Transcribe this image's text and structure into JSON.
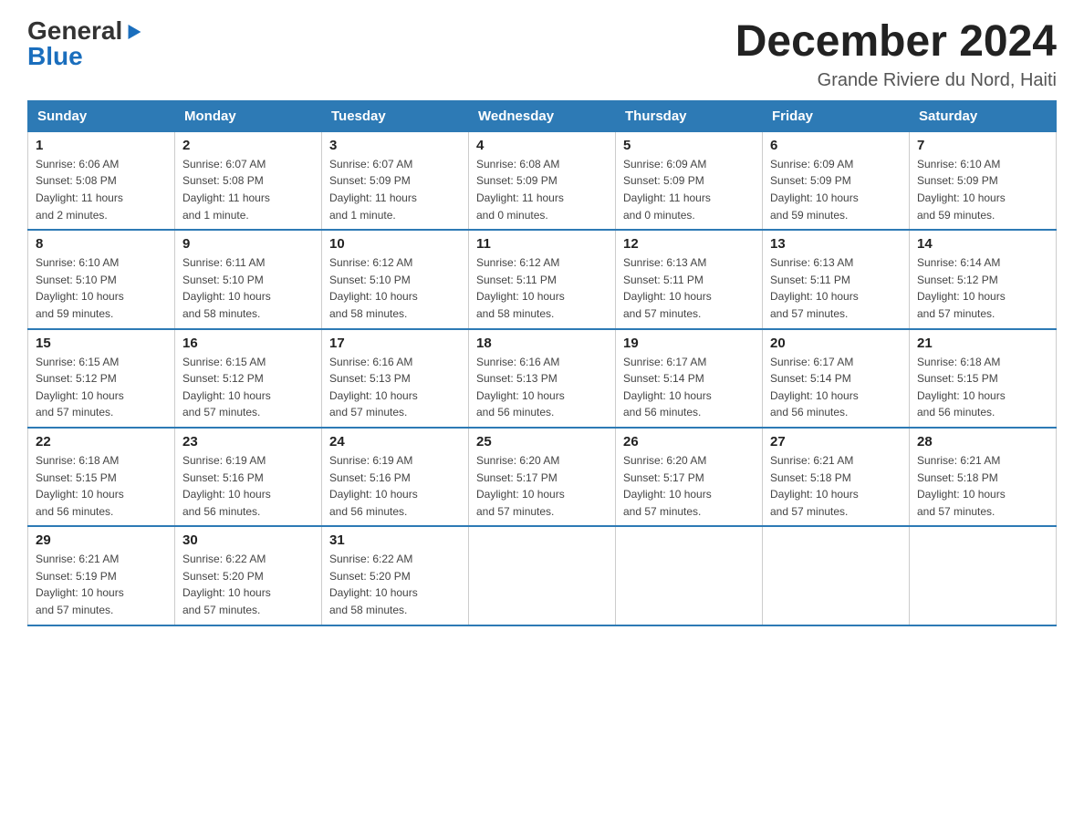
{
  "header": {
    "logo_general": "General",
    "logo_blue": "Blue",
    "month_title": "December 2024",
    "location": "Grande Riviere du Nord, Haiti"
  },
  "days_of_week": [
    "Sunday",
    "Monday",
    "Tuesday",
    "Wednesday",
    "Thursday",
    "Friday",
    "Saturday"
  ],
  "weeks": [
    [
      {
        "day": "1",
        "info": "Sunrise: 6:06 AM\nSunset: 5:08 PM\nDaylight: 11 hours\nand 2 minutes."
      },
      {
        "day": "2",
        "info": "Sunrise: 6:07 AM\nSunset: 5:08 PM\nDaylight: 11 hours\nand 1 minute."
      },
      {
        "day": "3",
        "info": "Sunrise: 6:07 AM\nSunset: 5:09 PM\nDaylight: 11 hours\nand 1 minute."
      },
      {
        "day": "4",
        "info": "Sunrise: 6:08 AM\nSunset: 5:09 PM\nDaylight: 11 hours\nand 0 minutes."
      },
      {
        "day": "5",
        "info": "Sunrise: 6:09 AM\nSunset: 5:09 PM\nDaylight: 11 hours\nand 0 minutes."
      },
      {
        "day": "6",
        "info": "Sunrise: 6:09 AM\nSunset: 5:09 PM\nDaylight: 10 hours\nand 59 minutes."
      },
      {
        "day": "7",
        "info": "Sunrise: 6:10 AM\nSunset: 5:09 PM\nDaylight: 10 hours\nand 59 minutes."
      }
    ],
    [
      {
        "day": "8",
        "info": "Sunrise: 6:10 AM\nSunset: 5:10 PM\nDaylight: 10 hours\nand 59 minutes."
      },
      {
        "day": "9",
        "info": "Sunrise: 6:11 AM\nSunset: 5:10 PM\nDaylight: 10 hours\nand 58 minutes."
      },
      {
        "day": "10",
        "info": "Sunrise: 6:12 AM\nSunset: 5:10 PM\nDaylight: 10 hours\nand 58 minutes."
      },
      {
        "day": "11",
        "info": "Sunrise: 6:12 AM\nSunset: 5:11 PM\nDaylight: 10 hours\nand 58 minutes."
      },
      {
        "day": "12",
        "info": "Sunrise: 6:13 AM\nSunset: 5:11 PM\nDaylight: 10 hours\nand 57 minutes."
      },
      {
        "day": "13",
        "info": "Sunrise: 6:13 AM\nSunset: 5:11 PM\nDaylight: 10 hours\nand 57 minutes."
      },
      {
        "day": "14",
        "info": "Sunrise: 6:14 AM\nSunset: 5:12 PM\nDaylight: 10 hours\nand 57 minutes."
      }
    ],
    [
      {
        "day": "15",
        "info": "Sunrise: 6:15 AM\nSunset: 5:12 PM\nDaylight: 10 hours\nand 57 minutes."
      },
      {
        "day": "16",
        "info": "Sunrise: 6:15 AM\nSunset: 5:12 PM\nDaylight: 10 hours\nand 57 minutes."
      },
      {
        "day": "17",
        "info": "Sunrise: 6:16 AM\nSunset: 5:13 PM\nDaylight: 10 hours\nand 57 minutes."
      },
      {
        "day": "18",
        "info": "Sunrise: 6:16 AM\nSunset: 5:13 PM\nDaylight: 10 hours\nand 56 minutes."
      },
      {
        "day": "19",
        "info": "Sunrise: 6:17 AM\nSunset: 5:14 PM\nDaylight: 10 hours\nand 56 minutes."
      },
      {
        "day": "20",
        "info": "Sunrise: 6:17 AM\nSunset: 5:14 PM\nDaylight: 10 hours\nand 56 minutes."
      },
      {
        "day": "21",
        "info": "Sunrise: 6:18 AM\nSunset: 5:15 PM\nDaylight: 10 hours\nand 56 minutes."
      }
    ],
    [
      {
        "day": "22",
        "info": "Sunrise: 6:18 AM\nSunset: 5:15 PM\nDaylight: 10 hours\nand 56 minutes."
      },
      {
        "day": "23",
        "info": "Sunrise: 6:19 AM\nSunset: 5:16 PM\nDaylight: 10 hours\nand 56 minutes."
      },
      {
        "day": "24",
        "info": "Sunrise: 6:19 AM\nSunset: 5:16 PM\nDaylight: 10 hours\nand 56 minutes."
      },
      {
        "day": "25",
        "info": "Sunrise: 6:20 AM\nSunset: 5:17 PM\nDaylight: 10 hours\nand 57 minutes."
      },
      {
        "day": "26",
        "info": "Sunrise: 6:20 AM\nSunset: 5:17 PM\nDaylight: 10 hours\nand 57 minutes."
      },
      {
        "day": "27",
        "info": "Sunrise: 6:21 AM\nSunset: 5:18 PM\nDaylight: 10 hours\nand 57 minutes."
      },
      {
        "day": "28",
        "info": "Sunrise: 6:21 AM\nSunset: 5:18 PM\nDaylight: 10 hours\nand 57 minutes."
      }
    ],
    [
      {
        "day": "29",
        "info": "Sunrise: 6:21 AM\nSunset: 5:19 PM\nDaylight: 10 hours\nand 57 minutes."
      },
      {
        "day": "30",
        "info": "Sunrise: 6:22 AM\nSunset: 5:20 PM\nDaylight: 10 hours\nand 57 minutes."
      },
      {
        "day": "31",
        "info": "Sunrise: 6:22 AM\nSunset: 5:20 PM\nDaylight: 10 hours\nand 58 minutes."
      },
      {
        "day": "",
        "info": ""
      },
      {
        "day": "",
        "info": ""
      },
      {
        "day": "",
        "info": ""
      },
      {
        "day": "",
        "info": ""
      }
    ]
  ]
}
